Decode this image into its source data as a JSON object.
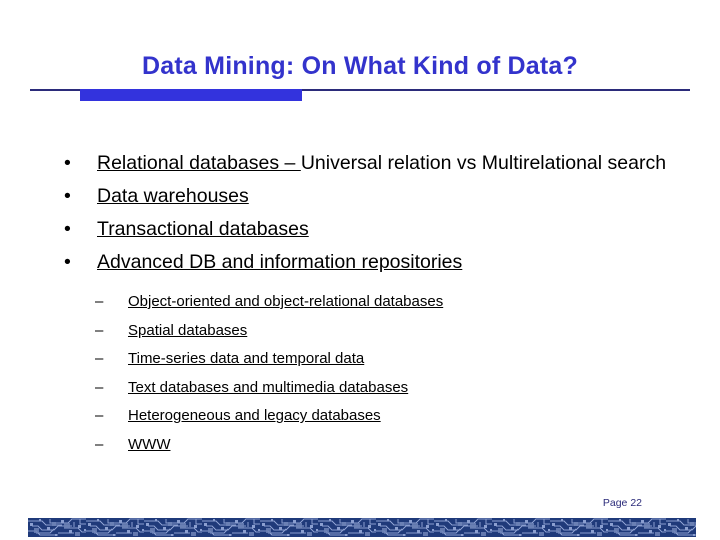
{
  "slide": {
    "title": "Data Mining: On What Kind of Data?",
    "title_color": "#3333cc",
    "rule_color": "#2b2b7a",
    "bar_color": "#3333dd",
    "page_label": "Page 22",
    "background": "#ffffff"
  },
  "bullets": [
    {
      "marker": "•",
      "underlined_text": "Relational databases – ",
      "plain_text": "Universal relation vs Multirelational search"
    },
    {
      "marker": "•",
      "underlined_text": "Data warehouses",
      "plain_text": ""
    },
    {
      "marker": "•",
      "underlined_text": "Transactional databases",
      "plain_text": ""
    },
    {
      "marker": "•",
      "underlined_text": "Advanced DB and information repositories",
      "plain_text": ""
    }
  ],
  "subbullets": [
    {
      "marker": "–",
      "text": "Object-oriented and object-relational databases"
    },
    {
      "marker": "–",
      "text": "Spatial databases"
    },
    {
      "marker": "–",
      "text": "Time-series data and temporal data"
    },
    {
      "marker": "–",
      "text": "Text databases and multimedia databases"
    },
    {
      "marker": "–",
      "text": "Heterogeneous and legacy databases"
    },
    {
      "marker": "–",
      "text": "WWW"
    }
  ],
  "footer": {
    "pattern_name": "circuit-board-strip",
    "dark_color": "#1f3a7a",
    "light_color": "#8b9fd0"
  }
}
